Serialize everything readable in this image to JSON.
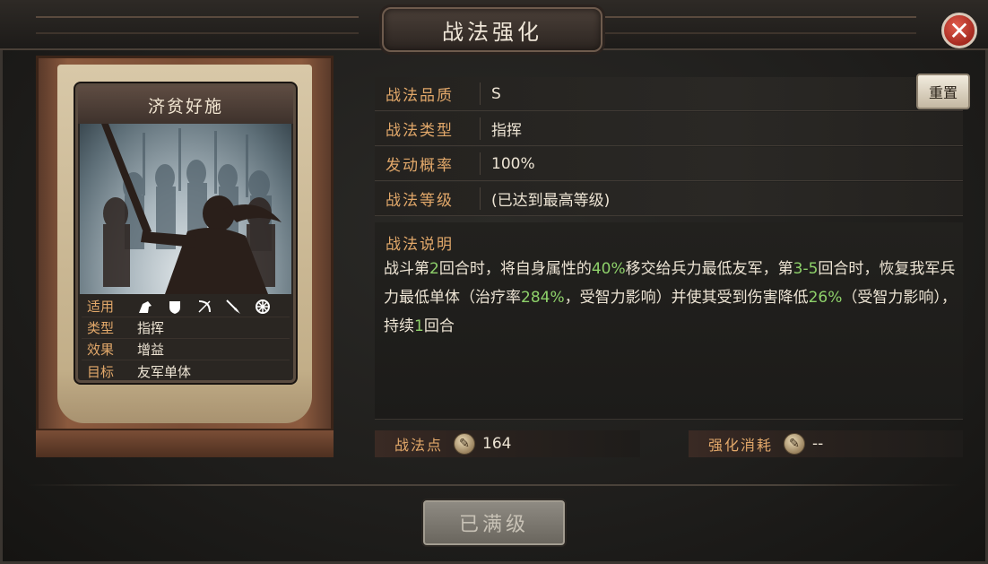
{
  "window": {
    "title": "战法强化",
    "close_icon": "close-icon"
  },
  "card": {
    "name": "济贫好施",
    "rows": [
      {
        "key": "适用",
        "value": "",
        "icons": [
          "cavalry-icon",
          "shield-icon",
          "bow-icon",
          "spear-icon",
          "wheel-icon"
        ]
      },
      {
        "key": "类型",
        "value": "指挥"
      },
      {
        "key": "效果",
        "value": "增益"
      },
      {
        "key": "目标",
        "value": "友军单体"
      }
    ]
  },
  "info": {
    "quality_label": "战法品质",
    "quality_value": "S",
    "type_label": "战法类型",
    "type_value": "指挥",
    "rate_label": "发动概率",
    "rate_value": "100%",
    "level_label": "战法等级",
    "level_value": "(已达到最高等级)",
    "reset_label": "重置"
  },
  "description": {
    "title": "战法说明",
    "parts": [
      {
        "t": "战斗第",
        "hl": false
      },
      {
        "t": "2",
        "hl": true
      },
      {
        "t": "回合时，将自身属性的",
        "hl": false
      },
      {
        "t": "40%",
        "hl": true
      },
      {
        "t": "移交给兵力最低友军，第",
        "hl": false
      },
      {
        "t": "3-5",
        "hl": true
      },
      {
        "t": "回合时，恢复我军兵力最低单体（治疗率",
        "hl": false
      },
      {
        "t": "284%",
        "hl": true
      },
      {
        "t": "，受智力影响）并使其受到伤害降低",
        "hl": false
      },
      {
        "t": "26%",
        "hl": true
      },
      {
        "t": "（受智力影响），持续",
        "hl": false
      },
      {
        "t": "1",
        "hl": true
      },
      {
        "t": "回合",
        "hl": false
      }
    ]
  },
  "points": {
    "label": "战法点",
    "value": "164",
    "cost_label": "强化消耗",
    "cost_value": "--"
  },
  "action": {
    "max_label": "已满级"
  },
  "colors": {
    "accent_label": "#e2a86a",
    "highlight": "#8ed16a",
    "close": "#c0392b"
  }
}
